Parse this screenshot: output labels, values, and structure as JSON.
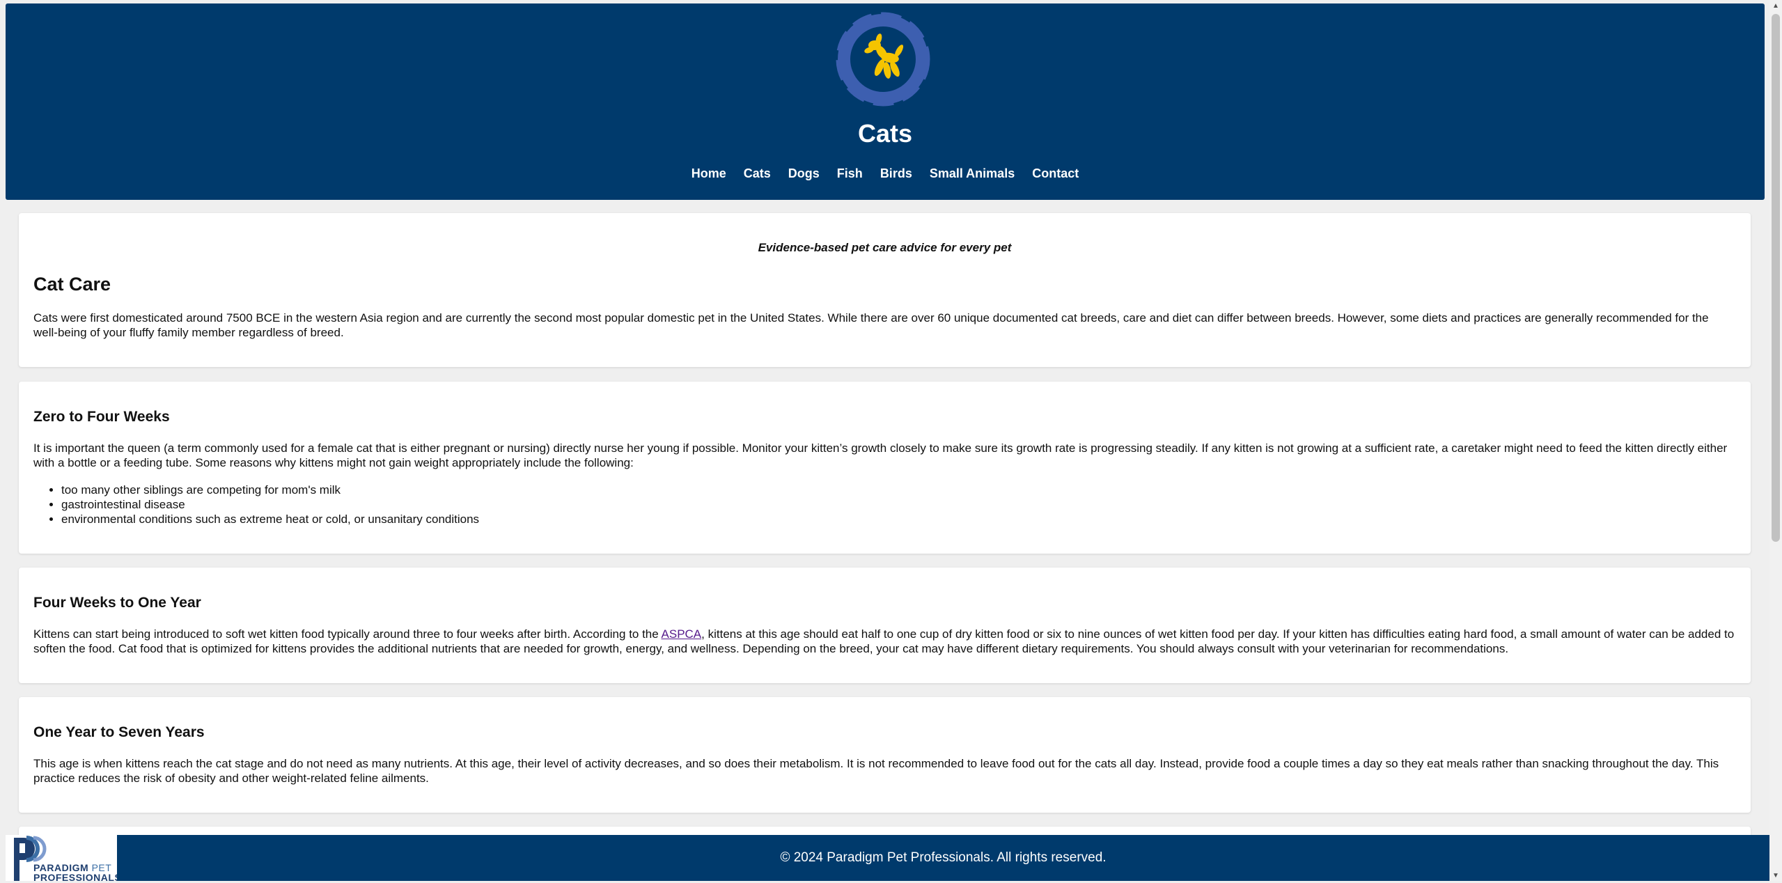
{
  "header": {
    "title": "Cats",
    "nav": [
      "Home",
      "Cats",
      "Dogs",
      "Fish",
      "Birds",
      "Small Animals",
      "Contact"
    ]
  },
  "intro": {
    "tagline": "Evidence-based pet care advice for every pet",
    "heading": "Cat Care",
    "text": "Cats were first domesticated around 7500 BCE in the western Asia region and are currently the second most popular domestic pet in the United States. While there are over 60 unique documented cat breeds, care and diet can differ between breeds. However, some diets and practices are generally recommended for the well-being of your fluffy family member regardless of breed."
  },
  "sections": [
    {
      "heading": "Zero to Four Weeks",
      "text": "It is important the queen (a term commonly used for a female cat that is either pregnant or nursing) directly nurse her young if possible. Monitor your kitten’s growth closely to make sure its growth rate is progressing steadily. If any kitten is not growing at a sufficient rate, a caretaker might need to feed the kitten directly either with a bottle or a feeding tube. Some reasons why kittens might not gain weight appropriately include the following:",
      "list": [
        "too many other siblings are competing for mom's milk",
        "gastrointestinal disease",
        "environmental conditions such as extreme heat or cold, or unsanitary conditions"
      ]
    },
    {
      "heading": "Four Weeks to One Year",
      "text_before": "Kittens can start being introduced to soft wet kitten food typically around three to four weeks after birth. According to the ",
      "link": "ASPCA",
      "text_after": ", kittens at this age should eat half to one cup of dry kitten food or six to nine ounces of wet kitten food per day. If your kitten has difficulties eating hard food, a small amount of water can be added to soften the food. Cat food that is optimized for kittens provides the additional nutrients that are needed for growth, energy, and wellness. Depending on the breed, your cat may have different dietary requirements. You should always consult with your veterinarian for recommendations."
    },
    {
      "heading": "One Year to Seven Years",
      "text": "This age is when kittens reach the cat stage and do not need as many nutrients. At this age, their level of activity decreases, and so does their metabolism. It is not recommended to leave food out for the cats all day. Instead, provide food a couple times a day so they eat meals rather than snacking throughout the day. This practice reduces the risk of obesity and other weight-related feline ailments."
    }
  ],
  "footer": {
    "copyright": "© 2024 Paradigm Pet Professionals. All rights reserved.",
    "logo_line1": "PARADIGM",
    "logo_pet": "PET",
    "logo_line2": "PROFESSIONALS"
  },
  "colors": {
    "header_bg": "#003a6c",
    "logo_ring": "#3d5fb0",
    "logo_dog": "#f5c400",
    "link_visited": "#551a8b"
  },
  "icons": {
    "header_logo": "balloon-dog-logo",
    "footer_logo": "paradigm-logo"
  }
}
